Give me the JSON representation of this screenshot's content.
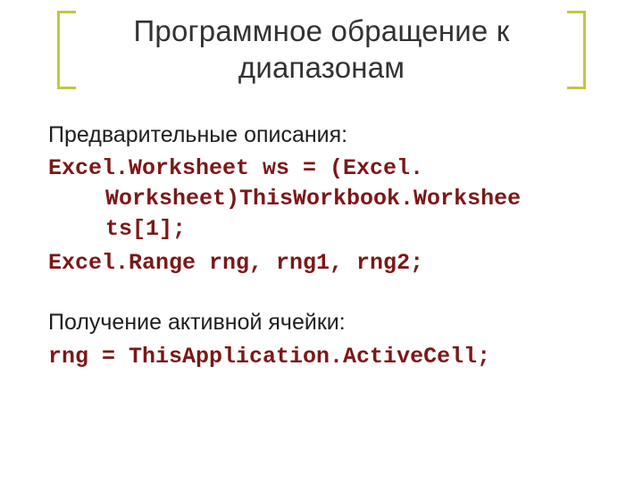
{
  "title": "Программное обращение к диапазонам",
  "section1_label": "Предварительные описания:",
  "code1_line1": "Excel.Worksheet ws = (Excel.",
  "code1_line2": "Worksheet)ThisWorkbook.Workshee",
  "code1_line3": "ts[1];",
  "code2": "Excel.Range rng, rng1, rng2;",
  "section2_label": "Получение активной ячейки:",
  "code3": "rng = ThisApplication.ActiveCell;"
}
